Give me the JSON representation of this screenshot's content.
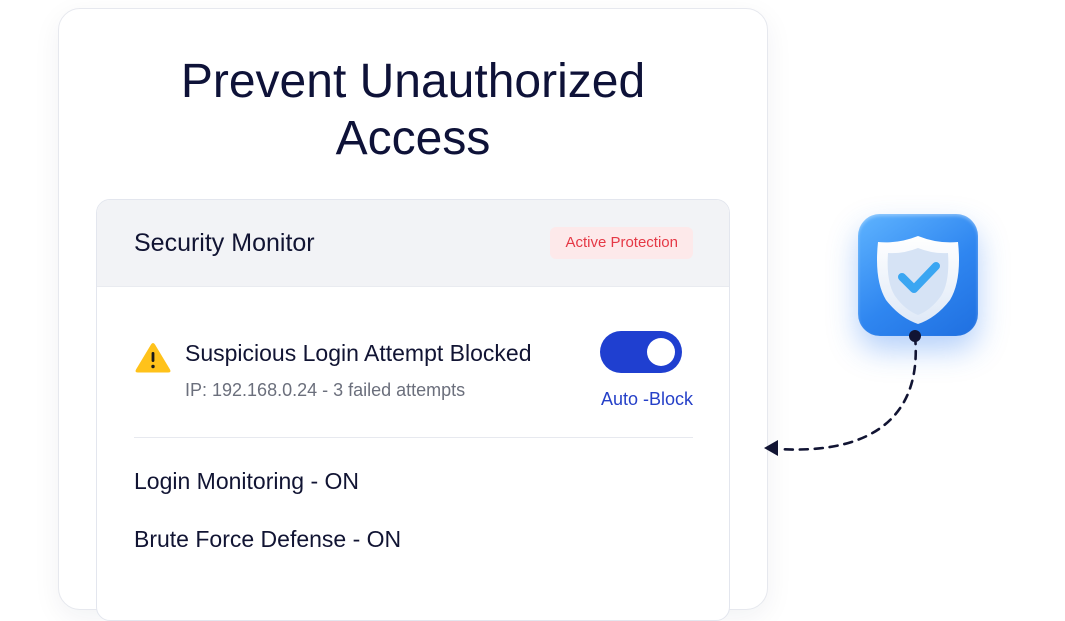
{
  "hero": {
    "title_line1": "Prevent Unauthorized",
    "title_line2": "Access"
  },
  "monitor": {
    "title": "Security Monitor",
    "badge": "Active Protection",
    "alert": {
      "icon": "warning-icon",
      "title": "Suspicious Login Attempt Blocked",
      "detail": "IP: 192.168.0.24 - 3 failed attempts"
    },
    "toggle": {
      "state": "on",
      "label": "Auto -Block"
    },
    "features": [
      "Login Monitoring - ON",
      "Brute Force Defense - ON"
    ]
  },
  "decor": {
    "shield_icon": "shield-check-icon",
    "connector": "dashed-arrow"
  },
  "colors": {
    "accent": "#1f3fd0",
    "danger": "#e53845",
    "danger_bg": "#fde9ea",
    "warning": "#ffc21a",
    "title": "#0e1238"
  }
}
